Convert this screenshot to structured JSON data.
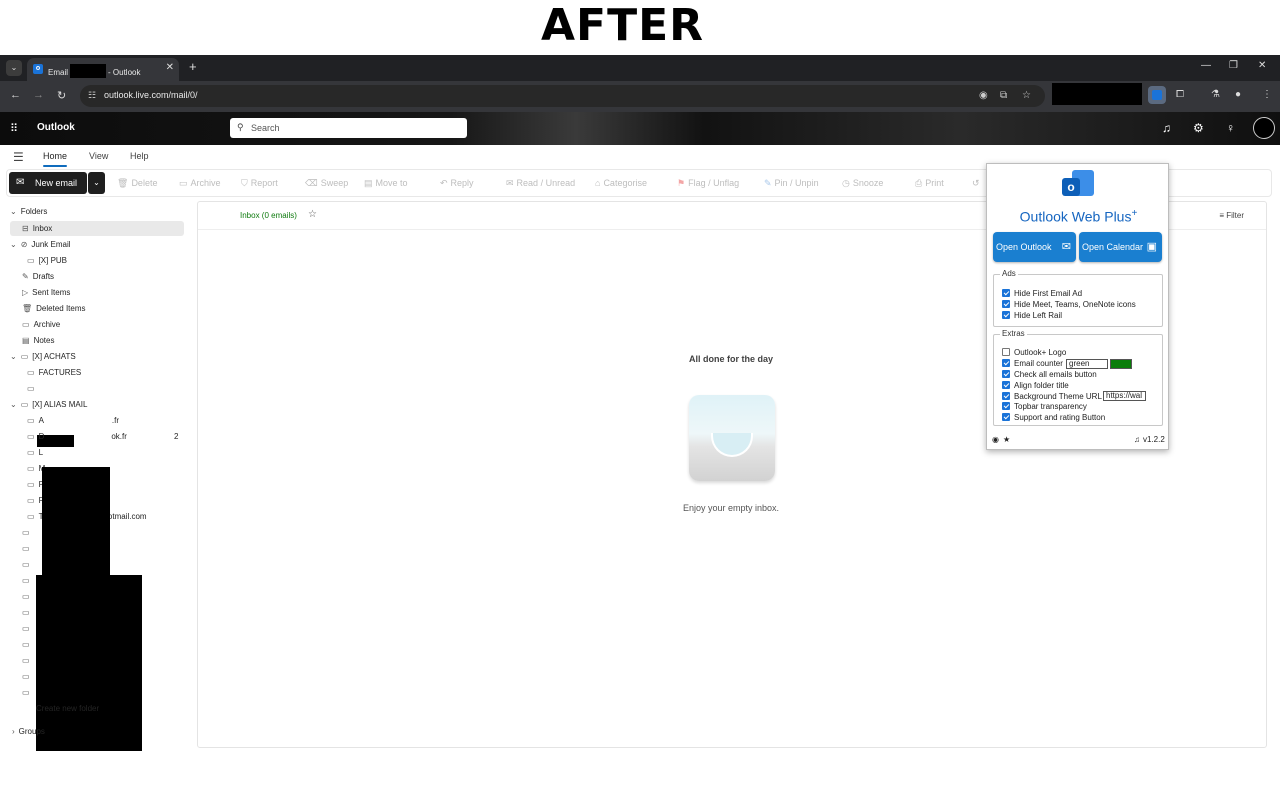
{
  "banner": {
    "text": "AFTER"
  },
  "browser": {
    "tab": {
      "title_prefix": "Email",
      "title_suffix": "- Outlook",
      "close": "✕"
    },
    "new_tab": "+",
    "url": "outlook.live.com/mail/0/"
  },
  "header": {
    "brand": "Outlook",
    "search_placeholder": "Search"
  },
  "menu": {
    "items": [
      "Home",
      "View",
      "Help"
    ]
  },
  "ribbon": {
    "new_email": "New email",
    "actions": [
      "Delete",
      "Archive",
      "Report",
      "Sweep",
      "Move to",
      "Reply",
      "Read / Unread",
      "Categorise",
      "Flag / Unflag",
      "Pin / Unpin",
      "Snooze",
      "Print"
    ]
  },
  "sidebar": {
    "folders_label": "Folders",
    "inbox": "Inbox",
    "junk": "Junk Email",
    "pub": "[X] PUB",
    "drafts": "Drafts",
    "sent": "Sent Items",
    "deleted": "Deleted Items",
    "archive": "Archive",
    "notes": "Notes",
    "achats": "[X] ACHATS",
    "factures": "FACTURES",
    "alias": "[X] ALIAS MAIL",
    "alias_items": [
      {
        "prefix": "A",
        "suffix": ".fr"
      },
      {
        "prefix": "D",
        "suffix": "ok.fr",
        "count": "2"
      },
      {
        "prefix": "L",
        "suffix": ""
      },
      {
        "prefix": "M",
        "suffix": ""
      },
      {
        "prefix": "P",
        "suffix": ""
      },
      {
        "prefix": "R",
        "suffix": ""
      },
      {
        "prefix": "T",
        "suffix": "hotmail.com"
      }
    ],
    "create_folder": "Create new folder",
    "groups": "Groups"
  },
  "main": {
    "inbox_header": "Inbox (0 emails)",
    "filter": "Filter",
    "empty_title": "All done for the day",
    "empty_sub": "Enjoy your empty inbox."
  },
  "popup": {
    "title": "Outlook Web Plus",
    "title_sup": "+",
    "open_outlook": "Open Outlook",
    "open_calendar": "Open Calendar",
    "ads_legend": "Ads",
    "ads": [
      {
        "label": "Hide First Email Ad",
        "checked": true
      },
      {
        "label": "Hide Meet, Teams, OneNote icons",
        "checked": true
      },
      {
        "label": "Hide Left Rail",
        "checked": true
      }
    ],
    "extras_legend": "Extras",
    "extras": [
      {
        "label": "Outlook+ Logo",
        "checked": false
      },
      {
        "label": "Email counter",
        "checked": true
      },
      {
        "label": "Check all emails button",
        "checked": true
      },
      {
        "label": "Align folder title",
        "checked": true
      },
      {
        "label": "Background Theme URL",
        "checked": true
      },
      {
        "label": "Topbar transparency",
        "checked": true
      },
      {
        "label": "Support and rating Button",
        "checked": true
      }
    ],
    "counter_color_value": "green",
    "counter_color_hex": "#0a7d0a",
    "theme_url_value": "https://wal",
    "version": "v1.2.2"
  },
  "colors": {
    "accent": "#0f6cbd",
    "popup_button": "#1a7fd0",
    "counter": "#0f7b0f"
  }
}
